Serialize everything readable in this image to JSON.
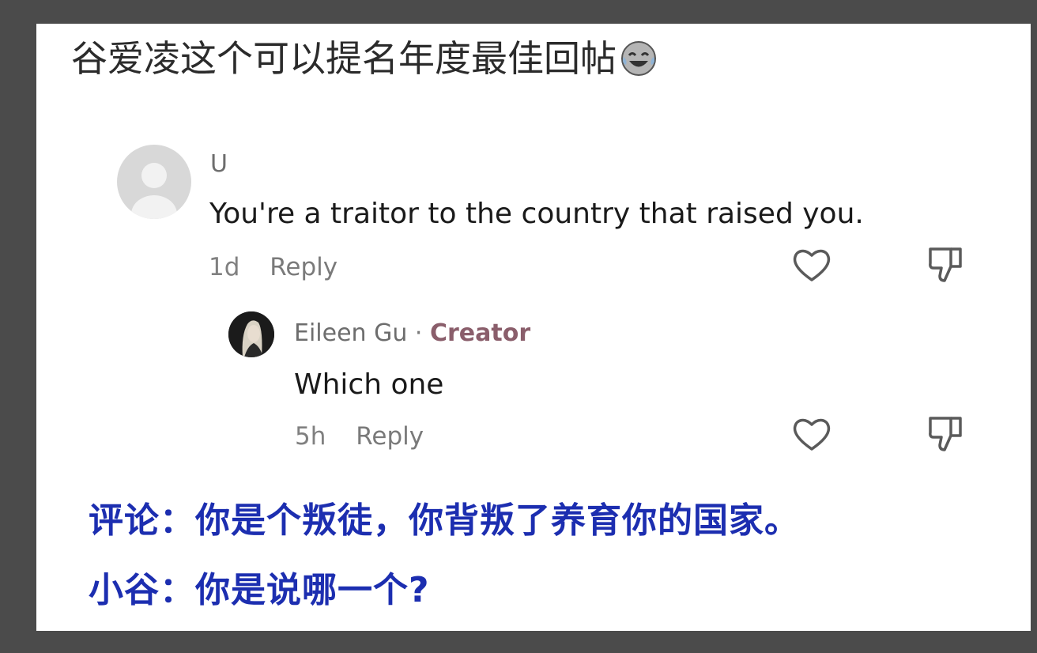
{
  "post": {
    "headline": "谷爱凌这个可以提名年度最佳回帖"
  },
  "comment": {
    "username": "U",
    "text": "You're a traitor to the country that raised you.",
    "time": "1d",
    "reply_label": "Reply",
    "like_icon": "heart-icon",
    "dislike_icon": "thumbs-down-icon"
  },
  "reply": {
    "username": "Eileen Gu",
    "separator": "·",
    "badge": "Creator",
    "text": "Which one",
    "time": "5h",
    "reply_label": "Reply",
    "like_icon": "heart-icon",
    "dislike_icon": "thumbs-down-icon"
  },
  "captions": {
    "line1": "评论：你是个叛徒，你背叛了养育你的国家。",
    "line2": "小谷：你是说哪一个?"
  },
  "colors": {
    "caption": "#1c2eb0",
    "creator_badge": "#8a5e6b"
  }
}
